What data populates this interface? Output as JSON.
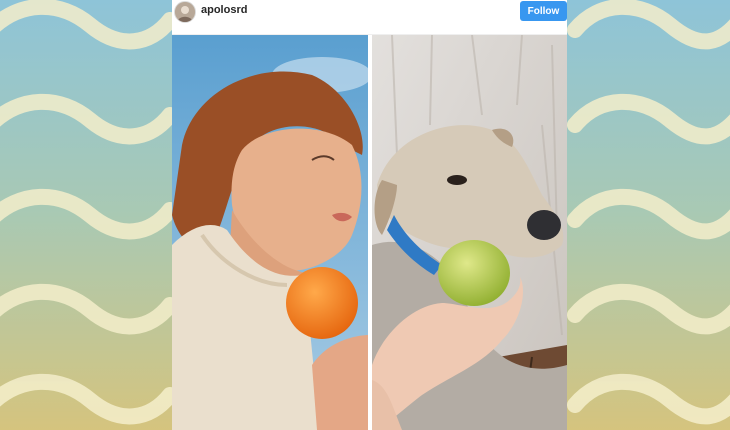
{
  "post": {
    "username": "apolosrd",
    "follow_label": "Follow"
  },
  "colors": {
    "follow_button": "#3897f0",
    "background_top": "#8fc3d6",
    "background_bottom": "#d6c780",
    "wave": "#f5efc9"
  },
  "icons": {
    "avatar": "profile-photo"
  }
}
